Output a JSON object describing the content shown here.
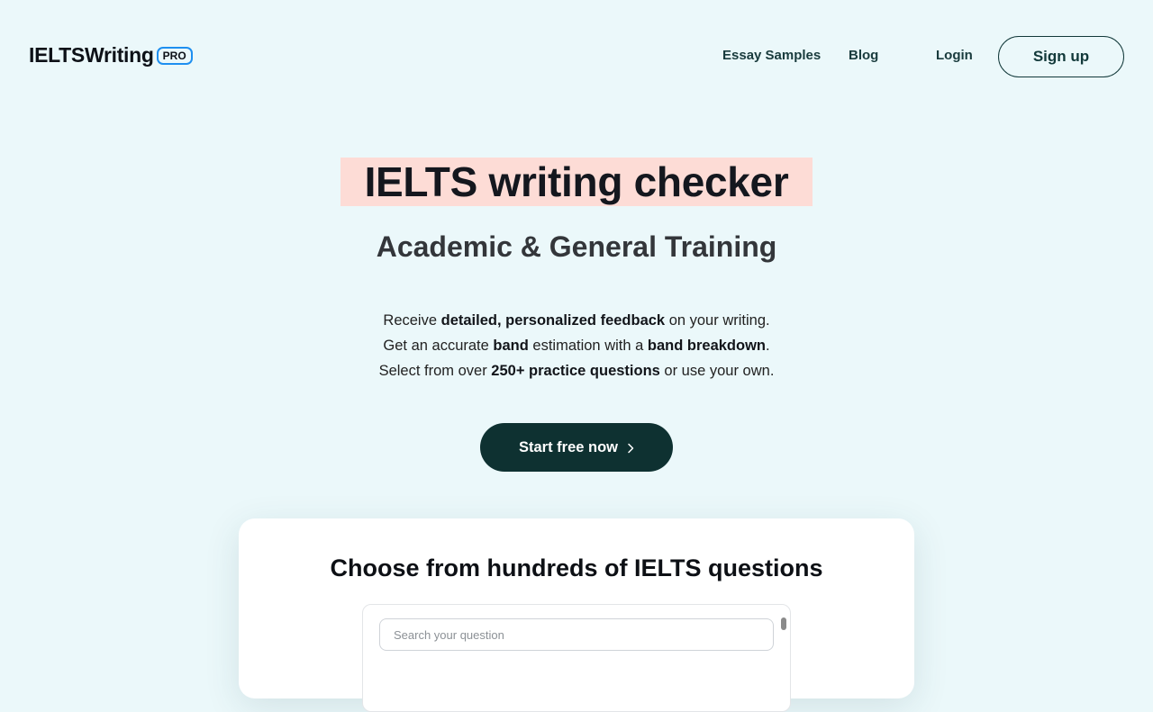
{
  "header": {
    "logo_text": "IELTSWriting",
    "logo_badge": "PRO",
    "nav": {
      "essay_samples": "Essay Samples",
      "blog": "Blog",
      "login": "Login",
      "signup": "Sign up"
    }
  },
  "hero": {
    "title": "IELTS writing checker",
    "subtitle": "Academic & General Training",
    "lines": [
      {
        "a": "Receive ",
        "b": "detailed, personalized feedback",
        "c": " on your writing."
      },
      {
        "a": "Get an accurate ",
        "b": "band",
        "c": " estimation with a ",
        "d": "band breakdown",
        "e": "."
      },
      {
        "a": "Select from over ",
        "b": "250+ practice questions",
        "c": " or use your own."
      }
    ],
    "cta_label": "Start free now",
    "cta_icon": "chevron-right-icon"
  },
  "questions_card": {
    "title": "Choose from hundreds of IELTS questions",
    "search_placeholder": "Search your question"
  },
  "colors": {
    "background": "#ebf8fa",
    "title_highlight": "#fddcd6",
    "cta_background": "#0e3131",
    "badge_border": "#1e8ff0"
  }
}
